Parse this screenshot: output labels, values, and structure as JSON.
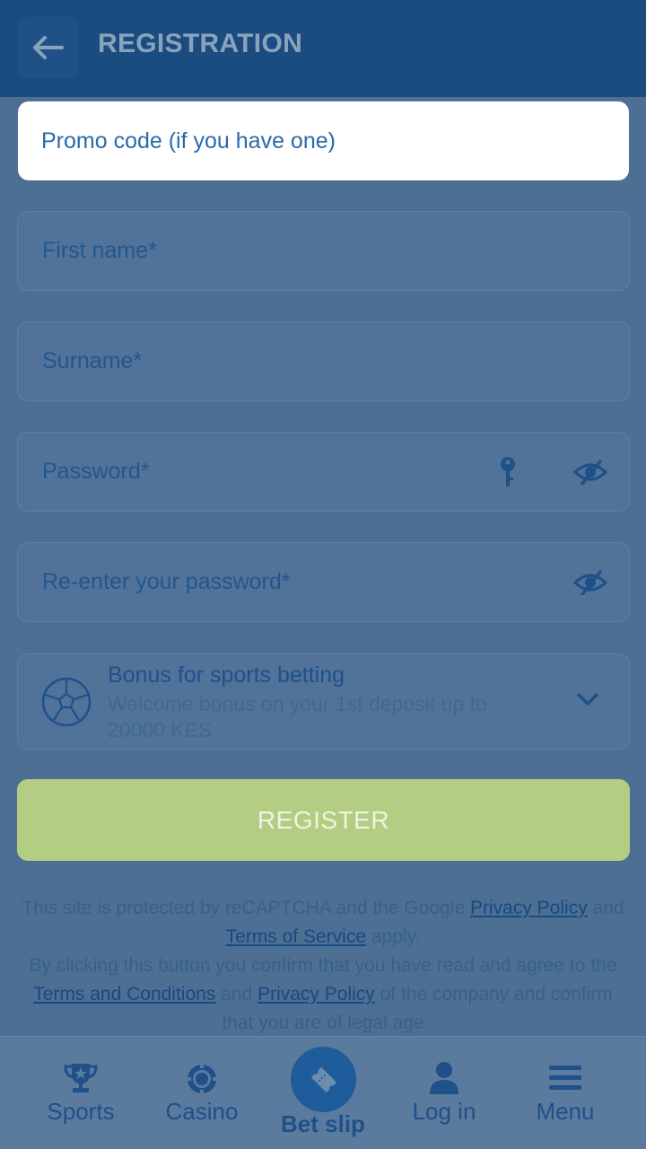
{
  "header": {
    "title": "REGISTRATION",
    "back_icon": "arrow-left-icon"
  },
  "form": {
    "promo_placeholder": "Promo code (if you have one)",
    "first_name_placeholder": "First name*",
    "surname_placeholder": "Surname*",
    "password_placeholder": "Password*",
    "reenter_password_placeholder": "Re-enter your password*",
    "password_icons": [
      "key-icon",
      "eye-slash-icon"
    ]
  },
  "bonus": {
    "title": "Bonus for sports betting",
    "subtitle": "Welcome bonus on your 1st deposit up to 20000 KES",
    "icon": "soccer-ball-icon"
  },
  "register_label": "REGISTER",
  "legal": {
    "line1_prefix": "This site is protected by reCAPTCHA and the Google",
    "privacy_policy": "Privacy Policy",
    "and1": "and",
    "terms_of_service": "Terms of Service",
    "apply": "apply.",
    "line2_prefix": "By clicking this button you confirm that you have read and agree to the",
    "terms_and_conditions": "Terms and Conditions",
    "and2": "and",
    "privacy_policy_2": "Privacy Policy",
    "line2_suffix": "of the company and confirm that you are of legal age"
  },
  "nav": {
    "sports": "Sports",
    "casino": "Casino",
    "bet_slip": "Bet slip",
    "log_in": "Log in",
    "menu": "Menu"
  },
  "colors": {
    "header_bg": "#1b4c80",
    "overlay_bg": "#4d6f94",
    "register_bg": "#b3cd82",
    "accent": "#1f5c9c"
  }
}
